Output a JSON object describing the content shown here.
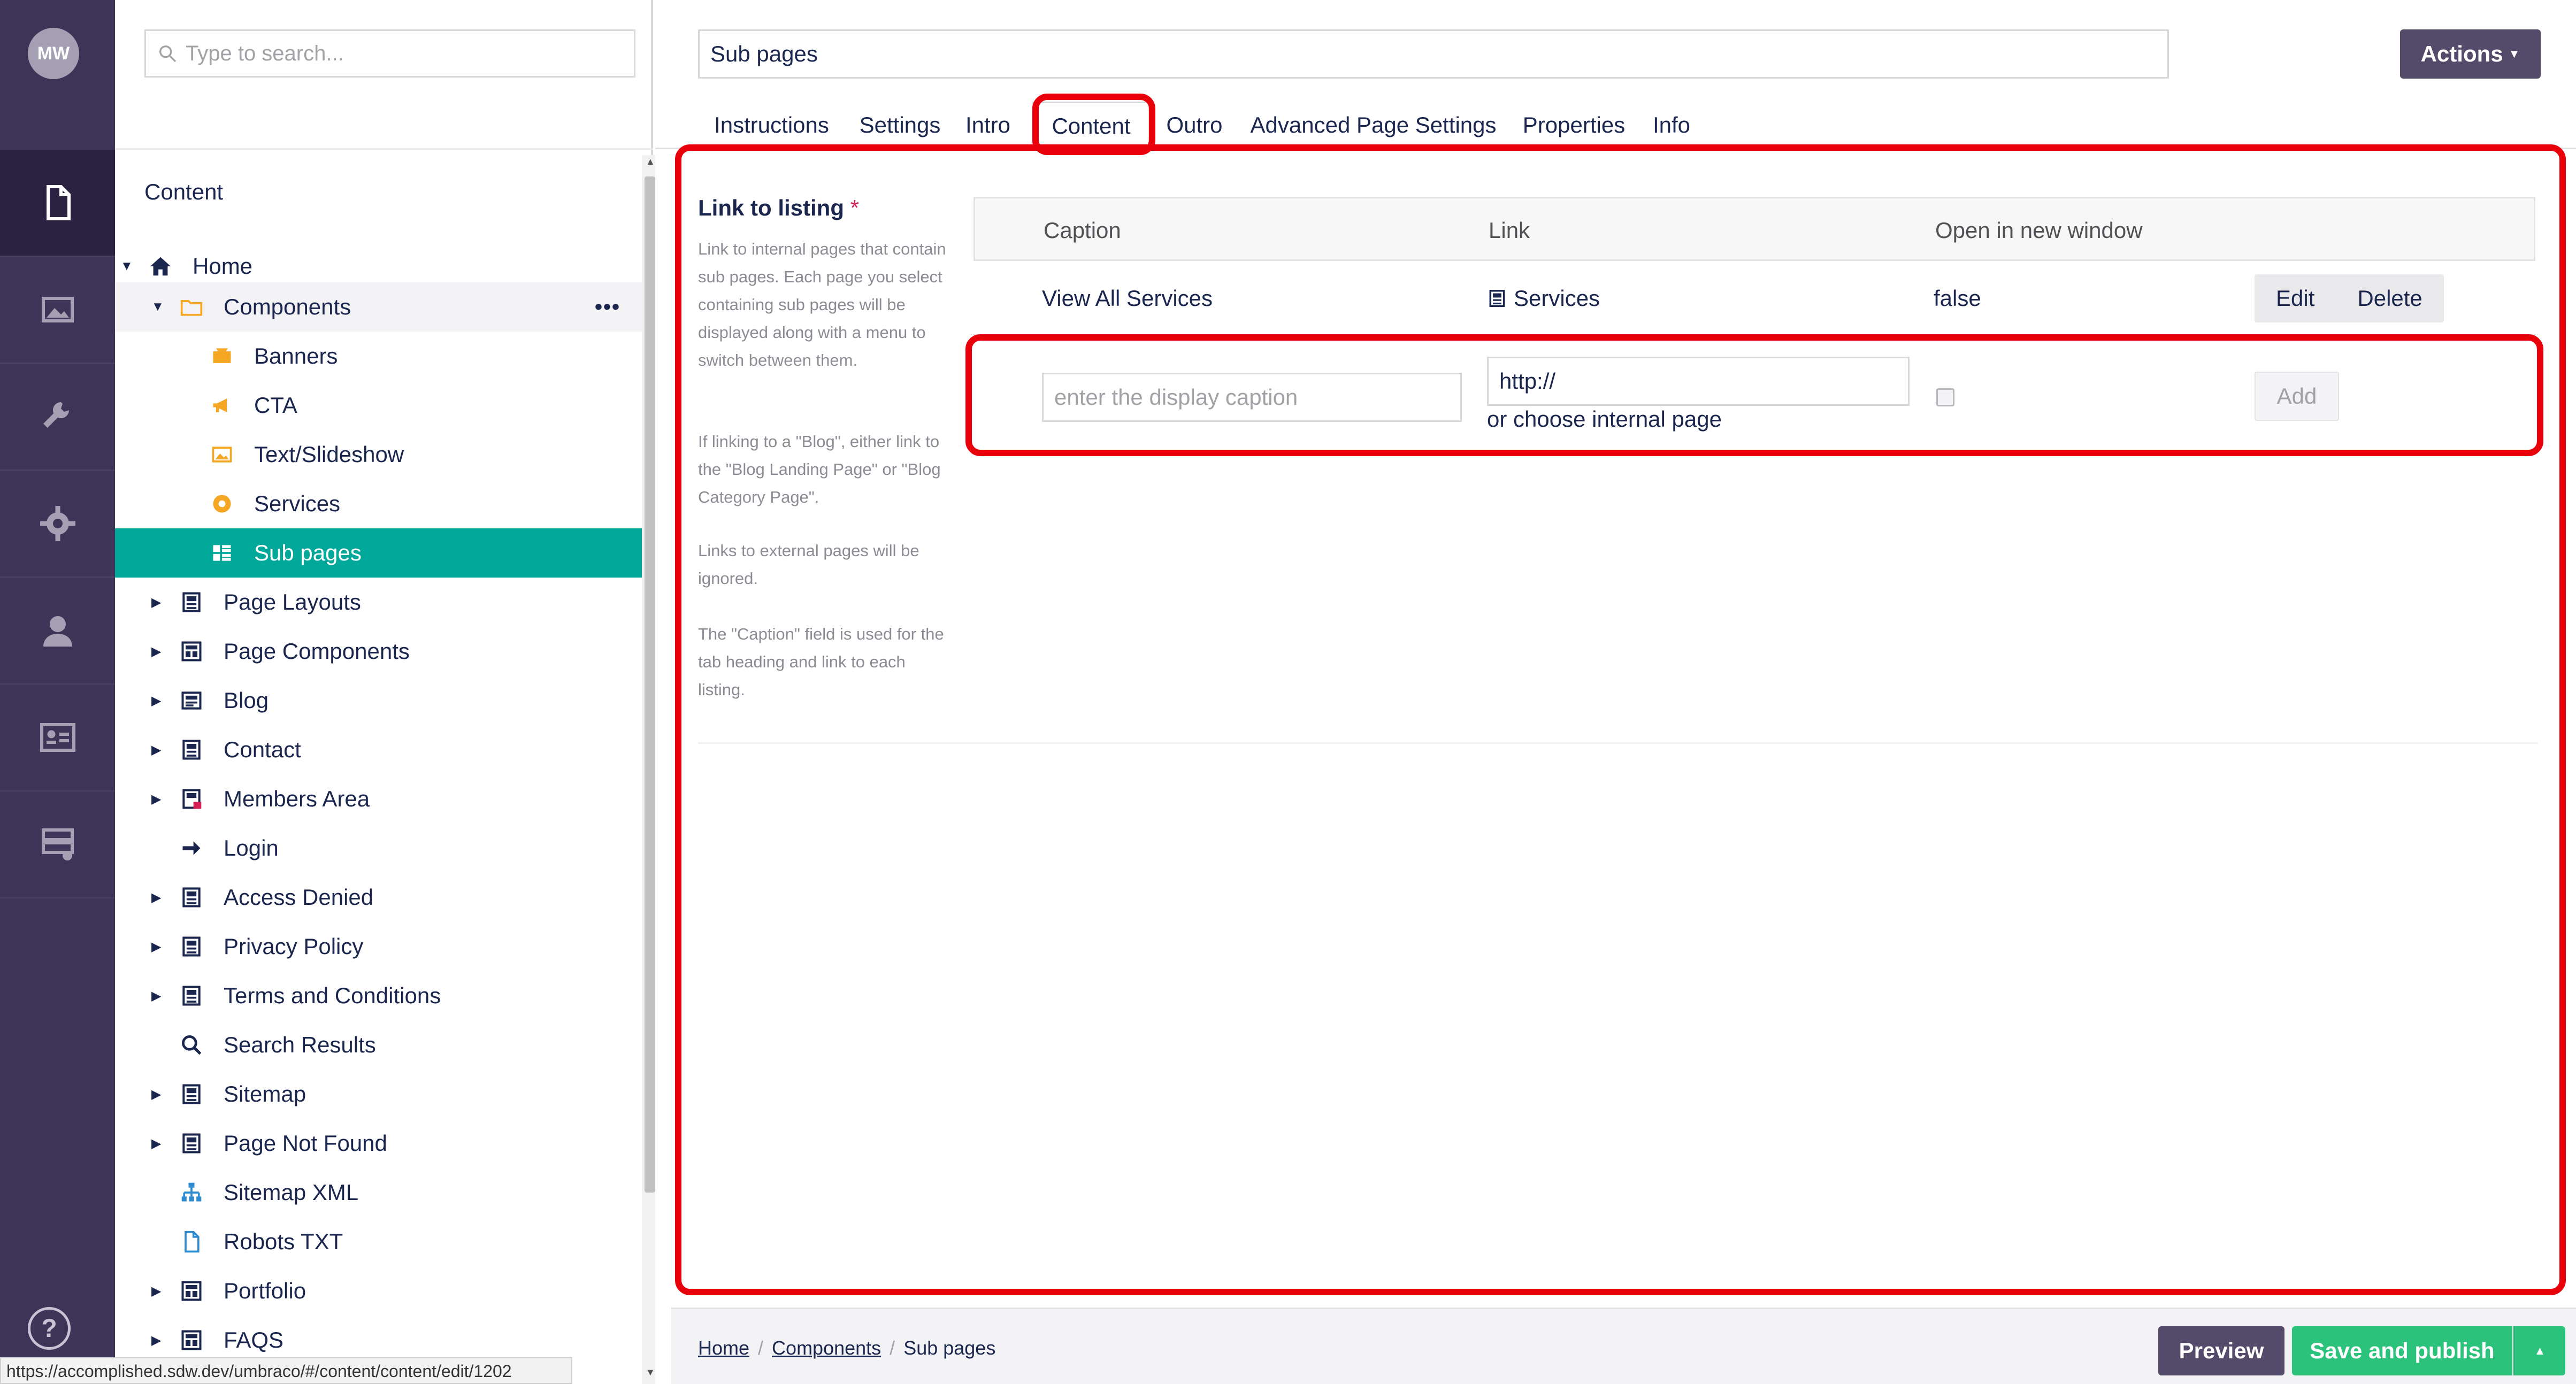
{
  "user": {
    "initials": "MW"
  },
  "rail": {
    "sections": [
      "content-icon",
      "media-icon",
      "wrench-icon",
      "gear-icon",
      "user-icon",
      "member-card-icon",
      "forms-icon"
    ],
    "help_icon": "question-circle-icon"
  },
  "tree": {
    "search_placeholder": "Type to search...",
    "title": "Content",
    "items": [
      {
        "label": "Home",
        "icon": "home-icon",
        "expanded": true
      },
      {
        "label": "Components",
        "icon": "folder-icon",
        "expanded": true,
        "more": "•••"
      },
      {
        "label": "Banners",
        "icon": "banner-icon"
      },
      {
        "label": "CTA",
        "icon": "megaphone-icon"
      },
      {
        "label": "Text/Slideshow",
        "icon": "image-icon"
      },
      {
        "label": "Services",
        "icon": "services-icon"
      },
      {
        "label": "Sub pages",
        "icon": "grid-list-icon",
        "selected": true
      },
      {
        "label": "Page Layouts",
        "icon": "doc-icon"
      },
      {
        "label": "Page Components",
        "icon": "layout-icon"
      },
      {
        "label": "Blog",
        "icon": "newspaper-icon"
      },
      {
        "label": "Contact",
        "icon": "doc-icon"
      },
      {
        "label": "Members Area",
        "icon": "doc-lock-icon"
      },
      {
        "label": "Login",
        "icon": "arrow-right-icon"
      },
      {
        "label": "Access Denied",
        "icon": "doc-icon"
      },
      {
        "label": "Privacy Policy",
        "icon": "doc-icon"
      },
      {
        "label": "Terms and Conditions",
        "icon": "doc-icon"
      },
      {
        "label": "Search Results",
        "icon": "search-icon"
      },
      {
        "label": "Sitemap",
        "icon": "doc-icon"
      },
      {
        "label": "Page Not Found",
        "icon": "doc-icon"
      },
      {
        "label": "Sitemap XML",
        "icon": "sitemap-icon"
      },
      {
        "label": "Robots TXT",
        "icon": "file-icon"
      },
      {
        "label": "Portfolio",
        "icon": "layout-icon"
      },
      {
        "label": "FAQS",
        "icon": "layout-icon"
      }
    ]
  },
  "status_url": "https://accomplished.sdw.dev/umbraco/#/content/content/edit/1202",
  "editor": {
    "name": "Sub pages",
    "actions_label": "Actions",
    "tabs": [
      "Instructions",
      "Settings",
      "Intro",
      "Content",
      "Outro",
      "Advanced Page Settings",
      "Properties",
      "Info"
    ],
    "active_tab": "Content"
  },
  "property": {
    "label": "Link to listing",
    "required_mark": "*",
    "description": [
      "Link to internal pages that contain sub pages. Each page you select containing sub pages will be displayed along with a menu to switch between them.",
      "If linking to a \"Blog\", either link to the \"Blog Landing Page\" or \"Blog Category Page\".",
      "Links to external pages will be ignored.",
      "The \"Caption\" field is used for the tab heading and link to each listing."
    ]
  },
  "links_table": {
    "headers": {
      "caption": "Caption",
      "link": "Link",
      "new_window": "Open in new window"
    },
    "rows": [
      {
        "caption": "View All Services",
        "link": "Services",
        "link_icon": "doc-icon",
        "new_window": "false",
        "edit": "Edit",
        "delete": "Delete"
      }
    ],
    "new_row": {
      "caption_placeholder": "enter the display caption",
      "link_value": "http://",
      "choose_internal": "or choose internal page",
      "new_window_checked": false,
      "add_label": "Add"
    }
  },
  "footer": {
    "breadcrumb": [
      "Home",
      "Components",
      "Sub pages"
    ],
    "separator": "/",
    "preview_label": "Preview",
    "publish_label": "Save and publish"
  },
  "colors": {
    "rail_bg": "#3e3458",
    "tree_selected": "#00a89a",
    "primary_button": "#544b6b",
    "publish_button": "#2bc37c",
    "highlight": "#e8000b"
  }
}
